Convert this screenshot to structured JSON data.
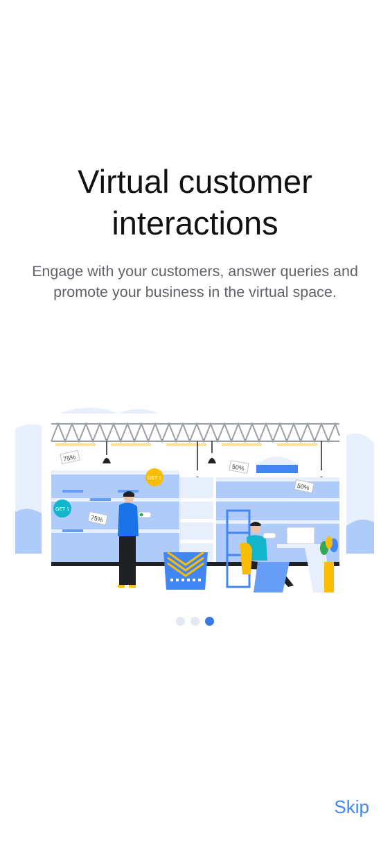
{
  "onboarding": {
    "title_line1": "Virtual customer",
    "title_line2": "interactions",
    "subtitle_line1": "Engage with your customers, answer queries and",
    "subtitle_line2": "promote your business in the virtual space."
  },
  "illustration": {
    "tag_75_a": "75%",
    "tag_75_b": "75%",
    "tag_50_a": "50%",
    "tag_50_b": "50%",
    "badge_get1_a": "GET 1",
    "badge_get1_b": "GET 1"
  },
  "pager": {
    "total": 3,
    "active_index": 2
  },
  "actions": {
    "skip_label": "Skip"
  },
  "colors": {
    "accent": "#4285f4",
    "dot_active": "#3b78e7",
    "dot_inactive": "#e3e8f1"
  }
}
